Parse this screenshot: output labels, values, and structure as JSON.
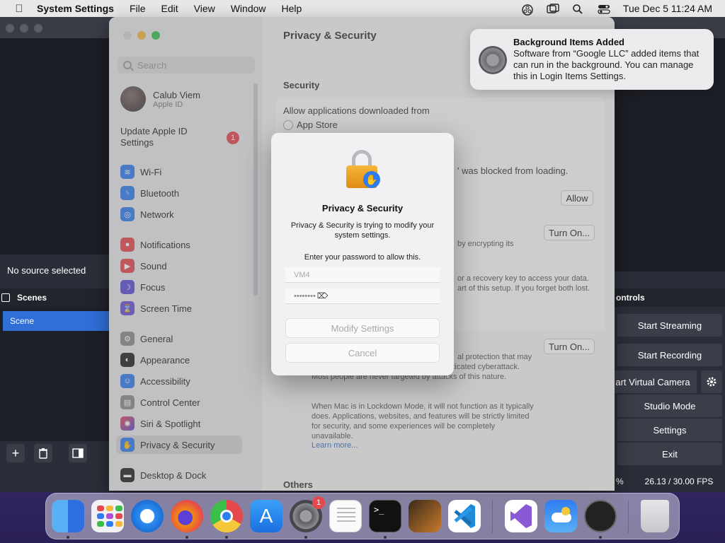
{
  "menubar": {
    "app_name": "System Settings",
    "items": [
      "File",
      "Edit",
      "View",
      "Window",
      "Help"
    ],
    "clock": "Tue Dec 5  11:24 AM"
  },
  "obs": {
    "no_source": "No source selected",
    "scenes_header": "Scenes",
    "scene_item": "Scene",
    "controls_header": "ontrols",
    "buttons": [
      "Start Streaming",
      "Start Recording",
      "art Virtual Camera",
      "Studio Mode",
      "Settings",
      "Exit"
    ],
    "status_percent": "%",
    "fps": "26.13 / 30.00 FPS"
  },
  "settings": {
    "search_placeholder": "Search",
    "user_name": "Calub Viem",
    "user_sub": "Apple ID",
    "update_text": "Update Apple ID Settings",
    "update_badge": "1",
    "sidebar": [
      {
        "label": "Wi-Fi",
        "color": "#2f7cf0"
      },
      {
        "label": "Bluetooth",
        "color": "#2f7cf0"
      },
      {
        "label": "Network",
        "color": "#2f7cf0"
      },
      {
        "label": "Notifications",
        "color": "#e5484d"
      },
      {
        "label": "Sound",
        "color": "#e5484d"
      },
      {
        "label": "Focus",
        "color": "#5b4fd6"
      },
      {
        "label": "Screen Time",
        "color": "#6a4fd6"
      },
      {
        "label": "General",
        "color": "#8a8a90"
      },
      {
        "label": "Appearance",
        "color": "#222222"
      },
      {
        "label": "Accessibility",
        "color": "#2f7cf0"
      },
      {
        "label": "Control Center",
        "color": "#8a8a90"
      },
      {
        "label": "Siri & Spotlight",
        "color": "#b04fd6"
      },
      {
        "label": "Privacy & Security",
        "color": "#2f7cf0"
      },
      {
        "label": "Desktop & Dock",
        "color": "#222222"
      }
    ],
    "page_title": "Privacy & Security",
    "section_security": "Security",
    "allow_from": "Allow applications downloaded from",
    "app_store": "App Store",
    "blocked_text": "' was blocked from loading.",
    "allow_btn": "Allow",
    "turn_on_1": "Turn On...",
    "encrypting": "by encrypting its",
    "recovery_text": "or a recovery key to access your data. art of this setup. If you forget both lost.",
    "turn_on_2": "Turn On...",
    "lockdown_text_1": "al protection that may be personally targeted by a highly sophisticated cyberattack. Most people are never targeted by attacks of this nature.",
    "lockdown_text_2": "When Mac is in Lockdown Mode, it will not function as it typically does. Applications, websites, and features will be strictly limited for security, and some experiences will be completely unavailable.",
    "learn_more": "Learn more...",
    "others": "Others"
  },
  "notification": {
    "title": "Background Items Added",
    "body": "Software from “Google LLC” added items that can run in the background. You can manage this in Login Items Settings."
  },
  "dialog": {
    "title": "Privacy & Security",
    "message": "Privacy & Security is trying to modify your system settings.",
    "prompt": "Enter your password to allow this.",
    "username": "VM4",
    "password": "••••••••",
    "modify_btn": "Modify Settings",
    "cancel_btn": "Cancel"
  },
  "dock": {
    "settings_badge": "1",
    "apps": [
      "finder-icon",
      "launchpad-icon",
      "safari-icon",
      "firefox-icon",
      "chrome-icon",
      "app-store-icon",
      "system-settings-icon",
      "textedit-icon",
      "terminal-icon",
      "garageband-icon",
      "vscode-icon",
      "visual-studio-icon",
      "weather-icon",
      "obs-icon",
      "trash-icon"
    ]
  }
}
